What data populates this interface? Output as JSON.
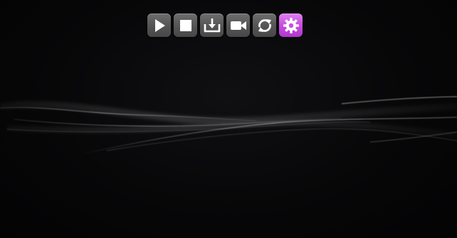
{
  "toolbar": {
    "buttons": [
      {
        "name": "play-button",
        "icon": "play-icon",
        "active": false
      },
      {
        "name": "stop-button",
        "icon": "stop-icon",
        "active": false
      },
      {
        "name": "download-button",
        "icon": "download-tray-icon",
        "active": false
      },
      {
        "name": "video-button",
        "icon": "video-camera-icon",
        "active": false
      },
      {
        "name": "refresh-button",
        "icon": "refresh-icon",
        "active": false
      },
      {
        "name": "settings-button",
        "icon": "gear-icon",
        "active": true
      }
    ],
    "colors": {
      "button": "#5a5a5a",
      "active": "#c84ee0",
      "icon": "#ffffff"
    }
  },
  "background": {
    "color": "#050506",
    "wave_color": "#bfbfbf"
  }
}
